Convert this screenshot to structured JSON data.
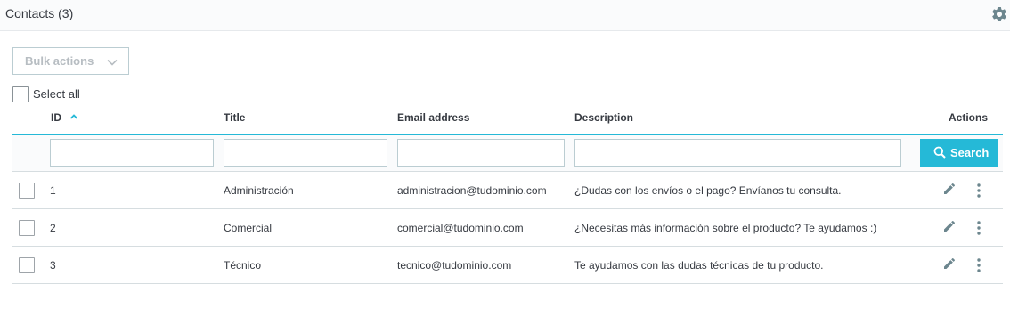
{
  "panel": {
    "title": "Contacts (3)",
    "settings_icon": "gear-icon"
  },
  "toolbar": {
    "bulk_actions_label": "Bulk actions",
    "select_all_label": "Select all"
  },
  "columns": {
    "id": "ID",
    "title": "Title",
    "email": "Email address",
    "description": "Description",
    "actions": "Actions"
  },
  "filters": {
    "search_label": "Search",
    "id_value": "",
    "title_value": "",
    "email_value": "",
    "description_value": ""
  },
  "rows": [
    {
      "id": "1",
      "title": "Administración",
      "email": "administracion@tudominio.com",
      "description": "¿Dudas con los envíos o el pago? Envíanos tu consulta."
    },
    {
      "id": "2",
      "title": "Comercial",
      "email": "comercial@tudominio.com",
      "description": "¿Necesitas más información sobre el producto? Te ayudamos :)"
    },
    {
      "id": "3",
      "title": "Técnico",
      "email": "tecnico@tudominio.com",
      "description": "Te ayudamos con las dudas técnicas de tu producto."
    }
  ],
  "colors": {
    "accent": "#25b9d7",
    "text": "#363a41",
    "border": "#bbcdd2",
    "muted": "#b7bdc2"
  }
}
